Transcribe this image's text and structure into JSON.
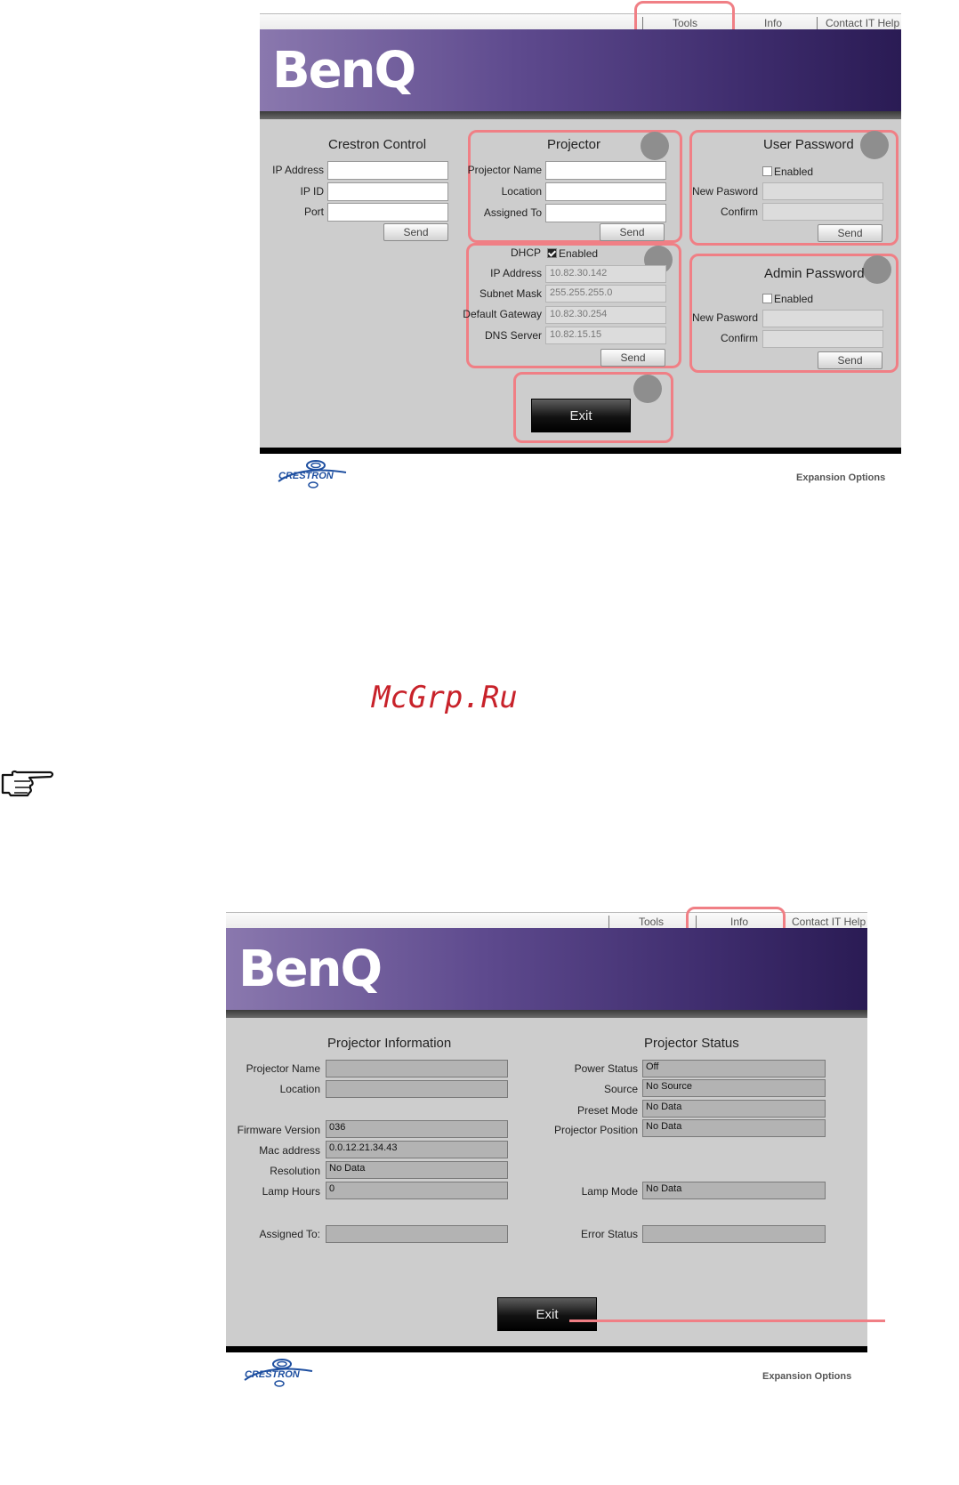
{
  "top": {
    "nav": {
      "tools": "Tools",
      "info": "Info",
      "help": "Contact IT Help"
    },
    "logo": "BenQ",
    "crestron": {
      "title": "Crestron Control",
      "ip_label": "IP Address",
      "ipid_label": "IP ID",
      "port_label": "Port",
      "send": "Send"
    },
    "projector": {
      "title": "Projector",
      "name_label": "Projector Name",
      "location_label": "Location",
      "assigned_label": "Assigned To",
      "send": "Send"
    },
    "network": {
      "dhcp_label": "DHCP",
      "dhcp_enabled": "Enabled",
      "ip_label": "IP Address",
      "ip_value": "10.82.30.142",
      "mask_label": "Subnet Mask",
      "mask_value": "255.255.255.0",
      "gw_label": "Default Gateway",
      "gw_value": "10.82.30.254",
      "dns_label": "DNS Server",
      "dns_value": "10.82.15.15",
      "send": "Send"
    },
    "user_password": {
      "title": "User Password",
      "enabled": "Enabled",
      "new_label": "New Pasword",
      "confirm_label": "Confirm",
      "send": "Send"
    },
    "admin_password": {
      "title": "Admin Password",
      "enabled": "Enabled",
      "new_label": "New Pasword",
      "confirm_label": "Confirm",
      "send": "Send"
    },
    "exit": "Exit",
    "footer": {
      "crestron_logo": "CRESTRON",
      "expansion": "Expansion Options"
    }
  },
  "watermark": "McGrp.Ru",
  "hand_icon": "pointing-hand-icon",
  "bottom": {
    "nav": {
      "tools": "Tools",
      "info": "Info",
      "help": "Contact IT Help"
    },
    "logo": "BenQ",
    "info": {
      "title": "Projector Information",
      "name_label": "Projector Name",
      "name_value": "",
      "location_label": "Location",
      "location_value": "",
      "firmware_label": "Firmware Version",
      "firmware_value": "036",
      "mac_label": "Mac address",
      "mac_value": "0.0.12.21.34.43",
      "res_label": "Resolution",
      "res_value": "No Data",
      "lamp_label": "Lamp Hours",
      "lamp_value": "0",
      "assigned_label": "Assigned To:",
      "assigned_value": ""
    },
    "status": {
      "title": "Projector Status",
      "power_label": "Power Status",
      "power_value": "Off",
      "source_label": "Source",
      "source_value": "No Source",
      "preset_label": "Preset Mode",
      "preset_value": "No Data",
      "position_label": "Projector Position",
      "position_value": "No Data",
      "lampmode_label": "Lamp Mode",
      "lampmode_value": "No Data",
      "error_label": "Error Status",
      "error_value": ""
    },
    "exit": "Exit",
    "footer": {
      "crestron_logo": "CRESTRON",
      "expansion": "Expansion Options"
    }
  },
  "colors": {
    "highlight": "#f07f85",
    "banner": "#4b3a7c",
    "panel": "#cdcdcd"
  }
}
